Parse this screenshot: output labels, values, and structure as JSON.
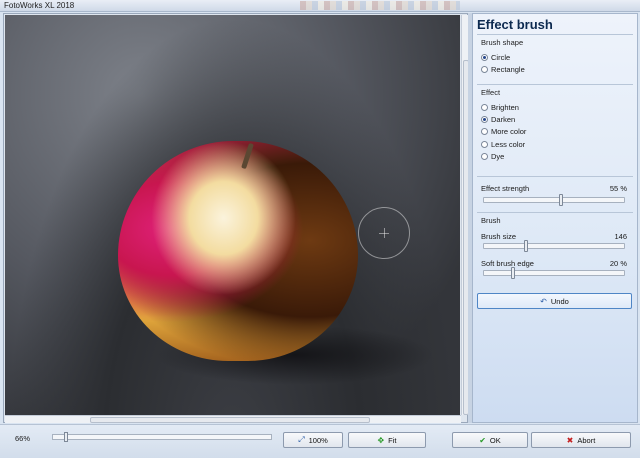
{
  "window": {
    "title": "FotoWorks XL 2018"
  },
  "panel": {
    "title": "Effect brush",
    "brush_shape": {
      "label": "Brush shape",
      "options": [
        {
          "label": "Circle",
          "selected": true
        },
        {
          "label": "Rectangle",
          "selected": false
        }
      ]
    },
    "effect": {
      "label": "Effect",
      "options": [
        {
          "label": "Brighten",
          "selected": false
        },
        {
          "label": "Darken",
          "selected": true
        },
        {
          "label": "More color",
          "selected": false
        },
        {
          "label": "Less color",
          "selected": false
        },
        {
          "label": "Dye",
          "selected": false
        }
      ]
    },
    "effect_strength": {
      "label": "Effect strength",
      "value": 55,
      "display": "55 %"
    },
    "brush": {
      "label": "Brush",
      "size": {
        "label": "Brush size",
        "value": 146,
        "max": 500,
        "display": "146"
      },
      "soft_edge": {
        "label": "Soft brush edge",
        "value": 20,
        "display": "20 %"
      }
    },
    "undo_label": "Undo"
  },
  "bottombar": {
    "zoom": {
      "display": "66%",
      "value": 0.05
    },
    "zoom100_label": "100%",
    "fit_label": "Fit",
    "ok_label": "OK",
    "abort_label": "Abort"
  },
  "icons": {
    "undo": "undo-icon",
    "zoom100": "zoom-100-icon",
    "fit": "fit-icon",
    "ok": "check-icon",
    "abort": "x-icon"
  }
}
